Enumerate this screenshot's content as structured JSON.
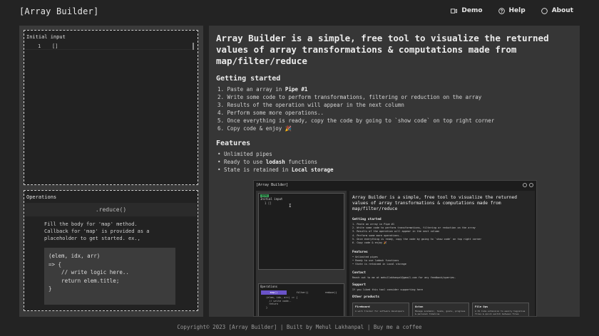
{
  "header": {
    "brand": "[Array Builder]",
    "nav": [
      {
        "label": "Demo",
        "icon": "video-icon"
      },
      {
        "label": "Help",
        "icon": "help-circle-icon"
      },
      {
        "label": "About",
        "icon": "info-circle-icon"
      }
    ]
  },
  "input_panel": {
    "title": "Initial input",
    "line_number": "1",
    "code": "[]"
  },
  "operations_panel": {
    "title": "Operations",
    "method": ".reduce()",
    "description": [
      "Fill the body for 'map' method.",
      "Callback for 'map' is provided as a",
      "placeholder to get started. ex.,"
    ],
    "code_lines": [
      "(elem, idx, arr)",
      "=> {",
      "    // write logic here..",
      "    return elem.title;",
      "}"
    ]
  },
  "intro": {
    "headline": "Array Builder is a simple, free tool to visualize the returned values of array transformations & computations made from map/filter/reduce",
    "getting_started_title": "Getting started",
    "steps": [
      {
        "pre": "1. Paste an array in ",
        "bold": "Pipe #1",
        "post": ""
      },
      {
        "pre": "2. Write some code to perform transformations, filtering or reduction on the array",
        "bold": "",
        "post": ""
      },
      {
        "pre": "3. Results of the operation will appear in the next column",
        "bold": "",
        "post": ""
      },
      {
        "pre": "4. Perform some more operations..",
        "bold": "",
        "post": ""
      },
      {
        "pre": "5. Once everything is ready, copy the code by going to `show code` on top right corner",
        "bold": "",
        "post": ""
      },
      {
        "pre": "6. Copy code & enjoy 🎉",
        "bold": "",
        "post": ""
      }
    ],
    "features_title": "Features",
    "features": [
      {
        "pre": "• Unlimited pipes",
        "bold": "",
        "post": ""
      },
      {
        "pre": "• Ready to use ",
        "bold": "lodash",
        "post": " functions"
      },
      {
        "pre": "• State is retained in ",
        "bold": "Local storage",
        "post": ""
      }
    ]
  },
  "preview": {
    "brand": "[Array Builder]",
    "tag": "DEMO",
    "input_title": "Initial input",
    "input_line": "1   []",
    "cursor": "I",
    "ops_title": "Operations",
    "tabs": [
      "map()",
      "filter()",
      "reduce()"
    ],
    "code": "(elem, idx, arr) => {\n  // write code..\n  return\n}",
    "headline": "Array Builder is a simple, free tool to visualize the returned values of array transformations & computations made from map/filter/reduce",
    "getting_started": "Getting started",
    "steps": [
      "1. Paste an array in Pipe #1",
      "2. Write some code to perform transformations, filtering or reduction on the array",
      "3. Results of the operation will appear in the next column",
      "4. Perform some more operations..",
      "5. Once everything is ready, copy the code by going to `show code` on top right corner",
      "6. Copy code & enjoy 🎉"
    ],
    "features_title": "Features",
    "features": [
      "• Unlimited pipes",
      "• Ready to use lodash functions",
      "• State is retained in Local storage"
    ],
    "contact_title": "Contact",
    "contact_text": "Reach out to me at mehullakhanpal@gmail.com for any feedback/queries.",
    "support_title": "Support",
    "support_text": "If you liked this tool consider supporting here",
    "other_title": "Other products",
    "products": [
      {
        "name": "Fireboard",
        "desc": "A work tracker for software developers"
      },
      {
        "name": "Octon",
        "desc": "Manage academic, tasks, goals, progress & personal timeline"
      },
      {
        "name": "File Ops",
        "desc": "A VS Code extension to easily tag/alias files & quick switch between files"
      }
    ]
  },
  "footer": {
    "text": "Copyright© 2023 [Array Builder] | Built by Mehul Lakhanpal | Buy me a coffee"
  }
}
